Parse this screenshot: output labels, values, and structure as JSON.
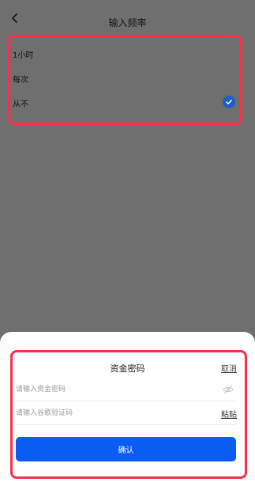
{
  "header": {
    "title": "输入频率"
  },
  "options": [
    {
      "label": "1小时",
      "selected": false
    },
    {
      "label": "每次",
      "selected": false
    },
    {
      "label": "从不",
      "selected": true
    }
  ],
  "sheet": {
    "title": "资金密码",
    "cancel_label": "取消",
    "password_placeholder": "请输入资金密码",
    "code_placeholder": "请输入谷歌验证码",
    "paste_label": "粘贴",
    "confirm_label": "确认"
  },
  "colors": {
    "accent": "#0a5cf5",
    "check": "#1f5ec5",
    "highlight_outline": "#ff2d4a",
    "overlay": "#6f6f6f"
  }
}
